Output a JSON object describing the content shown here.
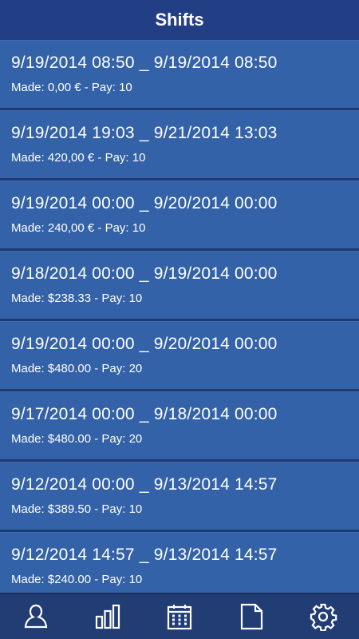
{
  "header": {
    "title": "Shifts"
  },
  "shifts": [
    {
      "range": "9/19/2014 08:50 _ 9/19/2014 08:50",
      "made": "Made: 0,00 € - Pay: 10"
    },
    {
      "range": "9/19/2014 19:03 _ 9/21/2014 13:03",
      "made": "Made: 420,00 € - Pay: 10"
    },
    {
      "range": "9/19/2014 00:00 _ 9/20/2014 00:00",
      "made": "Made: 240,00 € - Pay: 10"
    },
    {
      "range": "9/18/2014 00:00 _ 9/19/2014 00:00",
      "made": "Made: $238.33 - Pay: 10"
    },
    {
      "range": "9/19/2014 00:00 _ 9/20/2014 00:00",
      "made": "Made: $480.00 - Pay: 20"
    },
    {
      "range": "9/17/2014 00:00 _ 9/18/2014 00:00",
      "made": "Made: $480.00 - Pay: 20"
    },
    {
      "range": "9/12/2014 00:00 _ 9/13/2014 14:57",
      "made": "Made: $389.50 - Pay: 10"
    },
    {
      "range": "9/12/2014 14:57 _ 9/13/2014 14:57",
      "made": "Made: $240.00 - Pay: 10"
    }
  ],
  "bottom_nav": [
    {
      "icon": "profile-icon"
    },
    {
      "icon": "stats-icon"
    },
    {
      "icon": "calendar-icon"
    },
    {
      "icon": "document-icon"
    },
    {
      "icon": "settings-icon"
    }
  ],
  "colors": {
    "header": "#223f85",
    "item": "#3362a8",
    "nav": "#223c74",
    "text": "#ffffff"
  }
}
